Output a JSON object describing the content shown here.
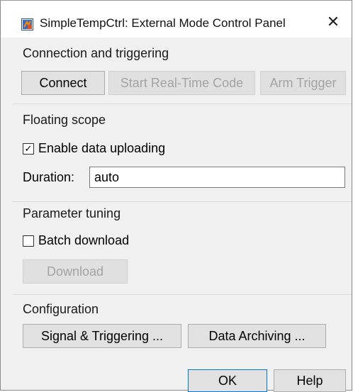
{
  "window": {
    "title": "SimpleTempCtrl: External Mode Control Panel",
    "close_glyph": "✕",
    "icon": "simulink-app-icon"
  },
  "connection": {
    "heading": "Connection and triggering",
    "connect_label": "Connect",
    "start_label": "Start Real-Time Code",
    "arm_label": "Arm Trigger"
  },
  "scope": {
    "heading": "Floating scope",
    "enable_label": "Enable data uploading",
    "enable_checked": true,
    "duration_label": "Duration:",
    "duration_value": "auto"
  },
  "tuning": {
    "heading": "Parameter tuning",
    "batch_label": "Batch download",
    "batch_checked": false,
    "download_label": "Download"
  },
  "configuration": {
    "heading": "Configuration",
    "signal_label": "Signal & Triggering ...",
    "archiving_label": "Data Archiving ..."
  },
  "footer": {
    "ok_label": "OK",
    "help_label": "Help"
  }
}
